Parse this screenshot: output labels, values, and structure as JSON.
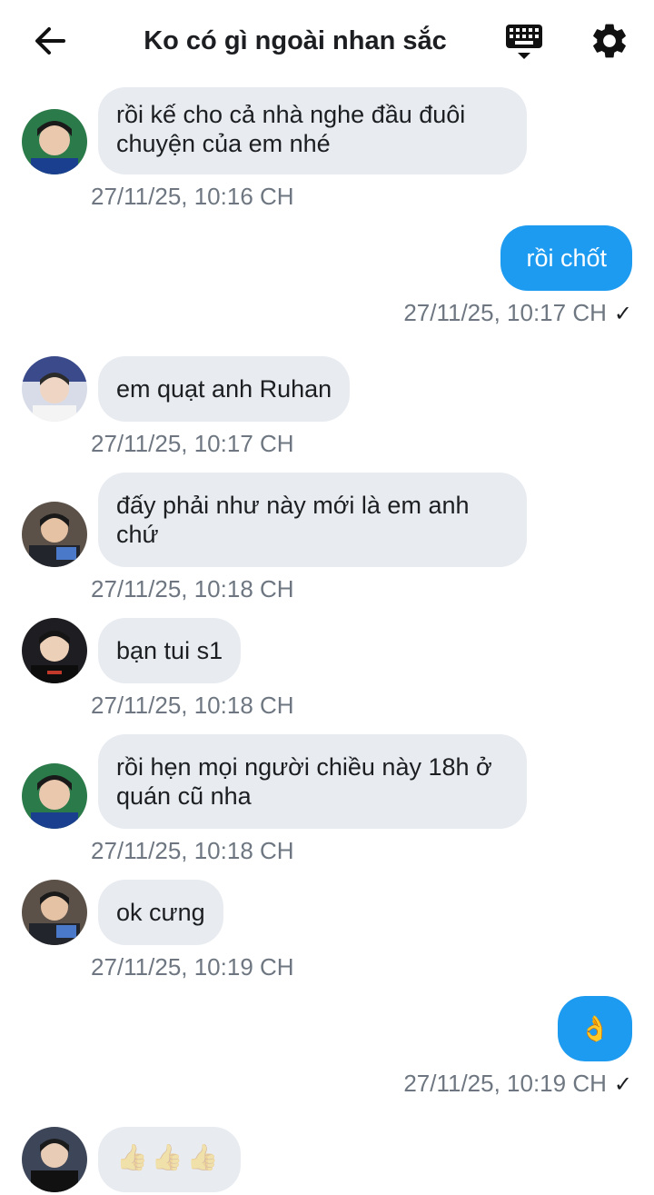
{
  "header": {
    "title": "Ko có gì ngoài nhan sắc",
    "back_icon": "arrow-left-icon",
    "keyboard_icon": "keyboard-icon",
    "settings_icon": "gear-icon"
  },
  "colors": {
    "incoming_bubble": "#e8ecf0",
    "outgoing_bubble": "#1d9bf0",
    "timestamp": "#6e7781"
  },
  "messages": [
    {
      "dir": "in",
      "lines": [
        "rồi kế cho cả nhà nghe đầu đuôi",
        "chuyện của em nhé"
      ],
      "time": "27/11/25, 10:16 CH"
    },
    {
      "dir": "out",
      "lines": [
        "rồi chốt"
      ],
      "time": "27/11/25, 10:17 CH",
      "read": "✓"
    },
    {
      "dir": "in",
      "lines": [
        "em quạt anh Ruhan"
      ],
      "time": "27/11/25, 10:17 CH"
    },
    {
      "dir": "in",
      "lines": [
        "đấy phải như này mới là em anh",
        "chứ"
      ],
      "time": "27/11/25, 10:18 CH"
    },
    {
      "dir": "in",
      "lines": [
        "bạn tui s1"
      ],
      "time": "27/11/25, 10:18 CH"
    },
    {
      "dir": "in",
      "lines": [
        "rồi hẹn mọi người chiều này 18h ở",
        "quán cũ nha"
      ],
      "time": "27/11/25, 10:18 CH"
    },
    {
      "dir": "in",
      "lines": [
        "ok cưng"
      ],
      "time": "27/11/25, 10:19 CH"
    },
    {
      "dir": "out",
      "lines": [
        "👌"
      ],
      "time": "27/11/25, 10:19 CH",
      "read": "✓"
    },
    {
      "dir": "in",
      "lines": [
        "👍👍👍"
      ],
      "time": ""
    }
  ]
}
